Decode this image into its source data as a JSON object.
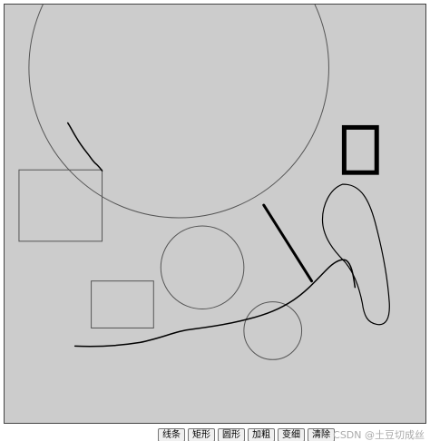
{
  "canvas": {
    "background_color": "#cccccc",
    "stroke_color": "#000000"
  },
  "toolbar": {
    "buttons": [
      {
        "id": "line",
        "label": "线条"
      },
      {
        "id": "rect",
        "label": "矩形"
      },
      {
        "id": "circle",
        "label": "圆形"
      },
      {
        "id": "thicken",
        "label": "加粗"
      },
      {
        "id": "thin",
        "label": "变细"
      },
      {
        "id": "clear",
        "label": "清除"
      }
    ]
  },
  "watermark": {
    "text": "CSDN @土豆切成丝"
  }
}
